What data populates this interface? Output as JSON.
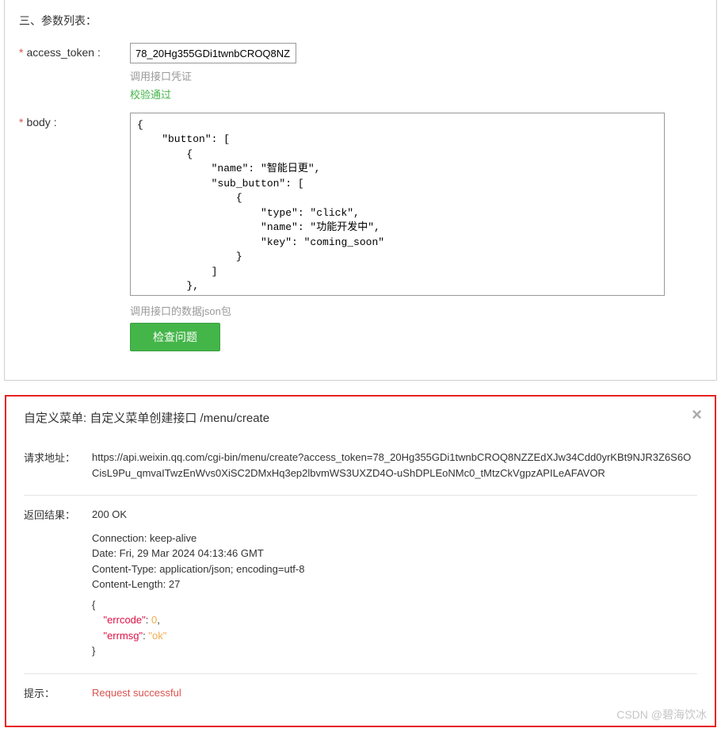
{
  "form": {
    "section_title": "三、参数列表：",
    "access_token": {
      "label": "access_token :",
      "value": "78_20Hg355GDi1twnbCROQ8NZ",
      "hint": "调用接口凭证",
      "validate": "校验通过"
    },
    "body": {
      "label": "body :",
      "value": "{\n    \"button\": [\n        {\n            \"name\": \"智能日更\",\n            \"sub_button\": [\n                {\n                    \"type\": \"click\",\n                    \"name\": \"功能开发中\",\n                    \"key\": \"coming_soon\"\n                }\n            ]\n        },\n        {\n            \"type\": \"miniprogram\",\n            \"name\": \"AI小程序\",",
      "hint": "调用接口的数据json包"
    },
    "submit_label": "检查问题"
  },
  "result": {
    "title": "自定义菜单: 自定义菜单创建接口 /menu/create",
    "request_url": {
      "label": "请求地址：",
      "value": "https://api.weixin.qq.com/cgi-bin/menu/create?access_token=78_20Hg355GDi1twnbCROQ8NZZEdXJw34Cdd0yrKBt9NJR3Z6S6OCisL9Pu_qmvaITwzEnWvs0XiSC2DMxHq3ep2lbvmWS3UXZD4O-uShDPLEoNMc0_tMtzCkVgpzAPILeAFAVOR"
    },
    "response": {
      "label": "返回结果：",
      "status": "200 OK",
      "headers": "Connection: keep-alive\nDate: Fri, 29 Mar 2024 04:13:46 GMT\nContent-Type: application/json; encoding=utf-8\nContent-Length: 27",
      "json": {
        "errcode_key": "\"errcode\"",
        "errcode_val": "0",
        "errmsg_key": "\"errmsg\"",
        "errmsg_val": "\"ok\""
      }
    },
    "tip": {
      "label": "提示：",
      "value": "Request successful"
    }
  },
  "watermark": "CSDN @碧海饮冰"
}
